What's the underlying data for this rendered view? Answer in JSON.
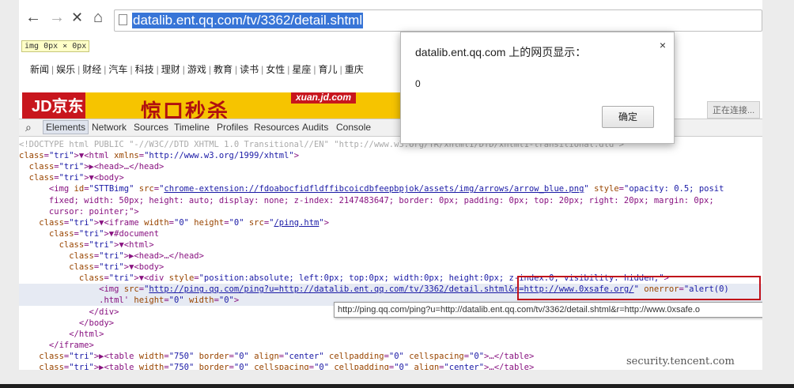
{
  "browser": {
    "url": "datalib.ent.qq.com/tv/3362/detail.shtml",
    "back_icon": "←",
    "forward_icon": "→",
    "stop_icon": "✕",
    "home_icon": "⌂"
  },
  "size_tip": "img 0px × 0px",
  "site_nav": [
    "新闻",
    "娱乐",
    "财经",
    "汽车",
    "科技",
    "理财",
    "游戏",
    "教育",
    "读书",
    "女性",
    "星座",
    "育儿",
    "重庆"
  ],
  "banner": {
    "logo": "JD京东",
    "slogan": "惊口秒杀",
    "tag": "xuan.jd.com"
  },
  "status": "正在连接...",
  "devtools": {
    "tabs": [
      "Elements",
      "Network",
      "Sources",
      "Timeline",
      "Profiles",
      "Resources",
      "Audits",
      "Console"
    ],
    "active_tab": "Elements"
  },
  "code_lines": [
    "<!DOCTYPE html PUBLIC \"-//W3C//DTD XHTML 1.0 Transitional//EN\" \"http://www.w3.org/TR/xhtml1/DTD/xhtml1-transitional.dtd\">",
    "▼<html xmlns=\"http://www.w3.org/1999/xhtml\">",
    "  ▶<head>…</head>",
    "  ▼<body>",
    "      <img id=\"STTBimg\" src=\"chrome-extension://fdoabocfidfldffibcoicdbfeepbpjok/assets/img/arrows/arrow_blue.png\" style=\"opacity: 0.5; posit",
    "      fixed; width: 50px; height: auto; display: none; z-index: 2147483647; border: 0px; padding: 0px; top: 20px; right: 20px; margin: 0px;",
    "      cursor: pointer;\">",
    "    ▼<iframe width=\"0\" height=\"0\" src=\"/ping.htm\">",
    "      ▼#document",
    "        ▼<html>",
    "          ▶<head>…</head>",
    "          ▼<body>",
    "            ▼<div style=\"position:absolute; left:0px; top:0px; width:0px; height:0px; z-index:0; visibility: hidden;\">",
    "                <img src=\"http://ping.qq.com/ping?u=http://datalib.ent.qq.com/tv/3362/detail.shtml&r=http://www.0xsafe.org/\" onerror=\"alert(0)",
    "                .html' height=\"0\" width=\"0\">",
    "              </div>",
    "            </body>",
    "          </html>",
    "      </iframe>",
    "    ▶<table width=\"750\" border=\"0\" align=\"center\" cellpadding=\"0\" cellspacing=\"0\">…</table>",
    "    ▶<table width=\"750\" border=\"0\" cellspacing=\"0\" cellpadding=\"0\" align=\"center\">…</table>"
  ],
  "hover_tip": "http://ping.qq.com/ping?u=http://datalib.ent.qq.com/tv/3362/detail.shtml&r=http://www.0xsafe.o",
  "watermark": "security.tencent.com",
  "dialog": {
    "title": "datalib.ent.qq.com 上的网页显示：",
    "message": "0",
    "ok": "确定",
    "close": "×"
  }
}
